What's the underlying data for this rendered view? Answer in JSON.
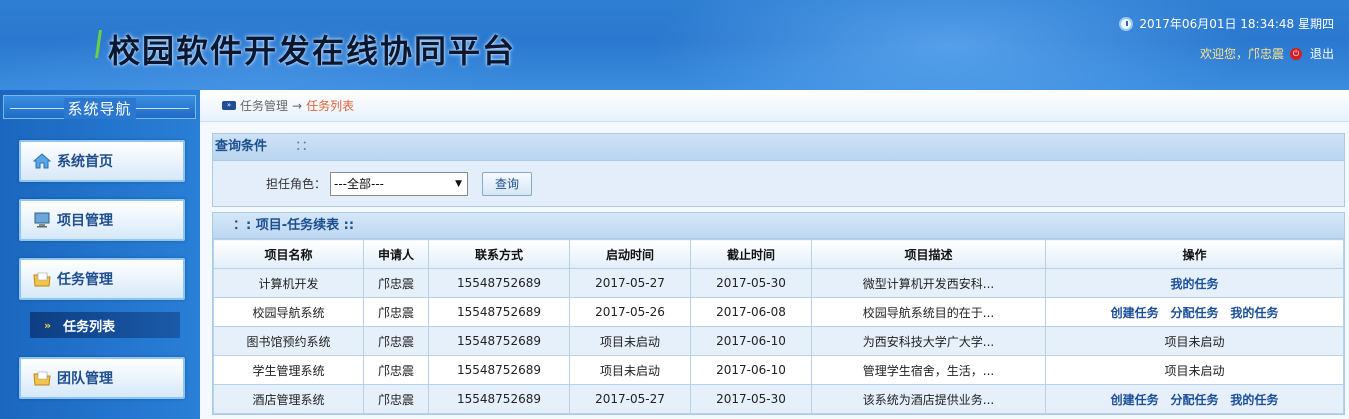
{
  "header": {
    "title": "校园软件开发在线协同平台",
    "datetime": "2017年06月01日 18:34:48 星期四",
    "welcome": "欢迎您，邝忠震",
    "logout": "退出"
  },
  "sidebar": {
    "heading": "系统导航",
    "items": [
      {
        "label": "系统首页",
        "icon": "home-icon"
      },
      {
        "label": "项目管理",
        "icon": "monitor-icon"
      },
      {
        "label": "任务管理",
        "icon": "folder-icon"
      },
      {
        "label": "团队管理",
        "icon": "folder-icon"
      }
    ],
    "sub_item": {
      "label": "任务列表",
      "icon": "double-chevron-icon"
    }
  },
  "breadcrumb": {
    "parent": "任务管理",
    "arrow": "→",
    "current": "任务列表"
  },
  "query_panel": {
    "title": "查询条件",
    "separator": "：：",
    "role_label": "担任角色：",
    "role_value": "---全部---",
    "query_button": "查询"
  },
  "table_panel": {
    "title": "：: 项目-任务续表 ::",
    "columns": [
      "项目名称",
      "申请人",
      "联系方式",
      "启动时间",
      "截止时间",
      "项目描述",
      "操作"
    ],
    "rows": [
      {
        "name": "计算机开发",
        "applicant": "邝忠震",
        "contact": "15548752689",
        "start": "2017-05-27",
        "end": "2017-05-30",
        "desc": "微型计算机开发西安科...",
        "ops": [
          "我的任务"
        ]
      },
      {
        "name": "校园导航系统",
        "applicant": "邝忠震",
        "contact": "15548752689",
        "start": "2017-05-26",
        "end": "2017-06-08",
        "desc": "校园导航系统目的在于...",
        "ops": [
          "创建任务",
          "分配任务",
          "我的任务"
        ]
      },
      {
        "name": "图书馆预约系统",
        "applicant": "邝忠震",
        "contact": "15548752689",
        "start": "项目未启动",
        "end": "2017-06-10",
        "desc": "为西安科技大学广大学...",
        "ops_text": "项目未启动"
      },
      {
        "name": "学生管理系统",
        "applicant": "邝忠震",
        "contact": "15548752689",
        "start": "项目未启动",
        "end": "2017-06-10",
        "desc": "管理学生宿舍，生活，...",
        "ops_text": "项目未启动"
      },
      {
        "name": "酒店管理系统",
        "applicant": "邝忠震",
        "contact": "15548752689",
        "start": "2017-05-27",
        "end": "2017-05-30",
        "desc": "该系统为酒店提供业务...",
        "ops": [
          "创建任务",
          "分配任务",
          "我的任务"
        ]
      }
    ]
  }
}
